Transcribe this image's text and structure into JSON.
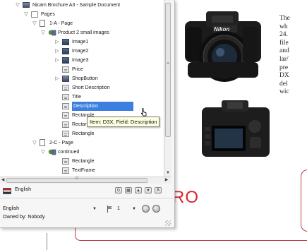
{
  "document": {
    "text_lines": [
      "The",
      "wh",
      "24.",
      "file",
      "and",
      "lar/",
      "pre",
      "DX",
      "del",
      "wic"
    ],
    "red_text": "RO"
  },
  "panel": {
    "tree": [
      {
        "label": "Nicam Brochure A3 - Sample Document",
        "icon": "document-icon",
        "twisty": "expanded"
      },
      {
        "label": "Pages",
        "icon": "folder-icon",
        "twisty": "expanded"
      },
      {
        "label": "1-A - Page",
        "icon": "page-icon",
        "twisty": "expanded"
      },
      {
        "label": "Product 2 small images",
        "icon": "group-icon",
        "twisty": "expanded"
      },
      {
        "label": "Image1",
        "icon": "image-icon",
        "twisty": "collapsed"
      },
      {
        "label": "Image2",
        "icon": "image-icon",
        "twisty": "collapsed"
      },
      {
        "label": "Image3",
        "icon": "image-icon",
        "twisty": "collapsed"
      },
      {
        "label": "Price",
        "icon": "field-icon",
        "twisty": "none"
      },
      {
        "label": "ShopButton",
        "icon": "shop-button-icon",
        "twisty": "collapsed"
      },
      {
        "label": "Short Description",
        "icon": "field-icon",
        "twisty": "none"
      },
      {
        "label": "Title",
        "icon": "field-icon",
        "twisty": "none"
      },
      {
        "label": "Description",
        "icon": "field-icon",
        "twisty": "none",
        "selected": true
      },
      {
        "label": "Rectangle",
        "icon": "field-icon",
        "twisty": "none"
      },
      {
        "label": "Rectangle",
        "icon": "field-icon",
        "twisty": "none"
      },
      {
        "label": "Rectangle",
        "icon": "field-icon",
        "twisty": "none"
      },
      {
        "label": "2-C - Page",
        "icon": "page-icon",
        "twisty": "expanded"
      },
      {
        "label": "continued",
        "icon": "group-icon",
        "twisty": "expanded"
      },
      {
        "label": "Rectangle",
        "icon": "field-icon",
        "twisty": "none"
      },
      {
        "label": "TextFrame",
        "icon": "field-icon",
        "twisty": "none"
      }
    ],
    "tooltip": "Item: D3X, Field: Description",
    "language": "English",
    "bottom": {
      "language_select": "English",
      "page_select": "1",
      "owner": "Owned by: Nobody"
    }
  },
  "colors": {
    "selection": "#3d7fe0",
    "accent_red": "#d7262c",
    "tooltip_bg": "#ffffe1"
  }
}
